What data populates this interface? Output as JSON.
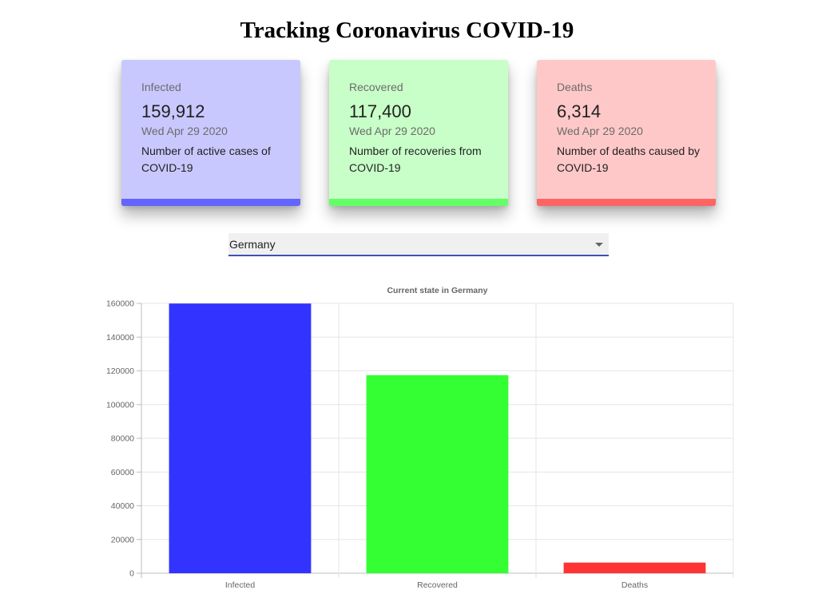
{
  "page": {
    "title": "Tracking Coronavirus COVID-19"
  },
  "cards": [
    {
      "label": "Infected",
      "count": "159,912",
      "date": "Wed Apr 29 2020",
      "description": "Number of active cases of COVID-19",
      "bg_color": "#c8c8ff",
      "accent_color": "#6464ff"
    },
    {
      "label": "Recovered",
      "count": "117,400",
      "date": "Wed Apr 29 2020",
      "description": "Number of recoveries from COVID-19",
      "bg_color": "#c8ffc8",
      "accent_color": "#64ff64"
    },
    {
      "label": "Deaths",
      "count": "6,314",
      "date": "Wed Apr 29 2020",
      "description": "Number of deaths caused by COVID-19",
      "bg_color": "#ffc8c8",
      "accent_color": "#ff6464"
    }
  ],
  "country_select": {
    "selected": "Germany",
    "underline_color": "#3f51b5"
  },
  "chart_data": {
    "type": "bar",
    "title": "Current state in Germany",
    "categories": [
      "Infected",
      "Recovered",
      "Deaths"
    ],
    "values": [
      159912,
      117400,
      6314
    ],
    "colors": [
      "#3333ff",
      "#33ff33",
      "#ff3333"
    ],
    "ylim": [
      0,
      160000
    ],
    "yticks": [
      0,
      20000,
      40000,
      60000,
      80000,
      100000,
      120000,
      140000,
      160000
    ],
    "xlabel": "",
    "ylabel": "",
    "grid": true,
    "legend": "none"
  }
}
